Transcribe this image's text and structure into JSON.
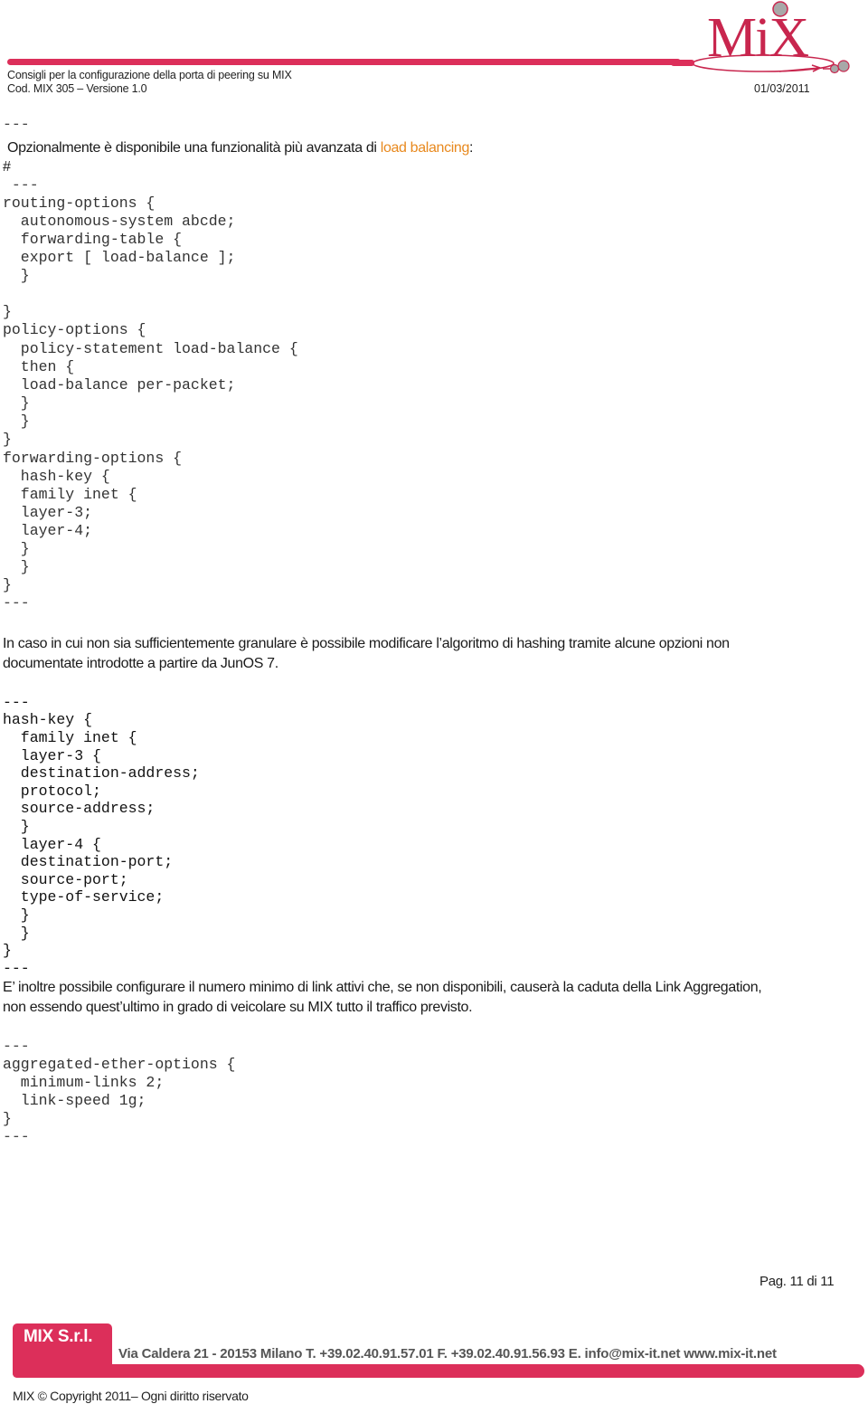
{
  "header": {
    "title": "Consigli per la configurazione della porta di peering su MIX",
    "code": "Cod. MIX 305 – Versione 1.0",
    "date": "01/03/2011",
    "logo_text": "MiX",
    "brand_color": "#dc2f5a"
  },
  "section1": {
    "sep_top": "---",
    "intro_prefix": "Opzionalmente è disponibile una funzionalità più avanzata di ",
    "intro_highlight": "load balancing",
    "intro_suffix": ":",
    "hash": "#",
    "sep2": " ---",
    "code": [
      "routing-options {",
      "  autonomous-system abcde;",
      "  forwarding-table {",
      "  export [ load-balance ];",
      "  }",
      "",
      "}",
      "policy-options {",
      "  policy-statement load-balance {",
      "  then {",
      "  load-balance per-packet;",
      "  }",
      "  }",
      "}",
      "forwarding-options {",
      "  hash-key {",
      "  family inet {",
      "  layer-3;",
      "  layer-4;",
      "  }",
      "  }",
      "}"
    ],
    "sep_end": "---"
  },
  "section2": {
    "para_line1": "In caso in cui non sia sufficientemente granulare è possibile modificare l’algoritmo di hashing tramite alcune opzioni non",
    "para_line2": "documentate introdotte a partire da JunOS 7.",
    "sep_top": "---",
    "code": [
      "hash-key {",
      "  family inet {",
      "  layer-3 {",
      "  destination-address;",
      "  protocol;",
      "  source-address;",
      "  }",
      "  layer-4 {",
      "  destination-port;",
      "  source-port;",
      "  type-of-service;",
      "  }",
      "  }",
      "}"
    ],
    "sep_end": "---"
  },
  "section3": {
    "para_line1": "E’ inoltre possibile configurare il numero minimo di link attivi che, se non disponibili, causerà la caduta della Link Aggregation,",
    "para_line2": "non essendo quest’ultimo in grado di veicolare su MIX tutto il traffico previsto.",
    "sep_top": "---",
    "code": [
      "aggregated-ether-options {",
      "  minimum-links 2;",
      "  link-speed 1g;",
      "}"
    ],
    "sep_end": "---"
  },
  "footer": {
    "page": "Pag. 11 di 11",
    "brand": "MIX S.r.l.",
    "address": "Via Caldera 21 - 20153 Milano T. +39.02.40.91.57.01 F. +39.02.40.91.56.93 E. info@mix-it.net  www.mix-it.net",
    "copyright": "MIX © Copyright 2011– Ogni diritto riservato"
  }
}
